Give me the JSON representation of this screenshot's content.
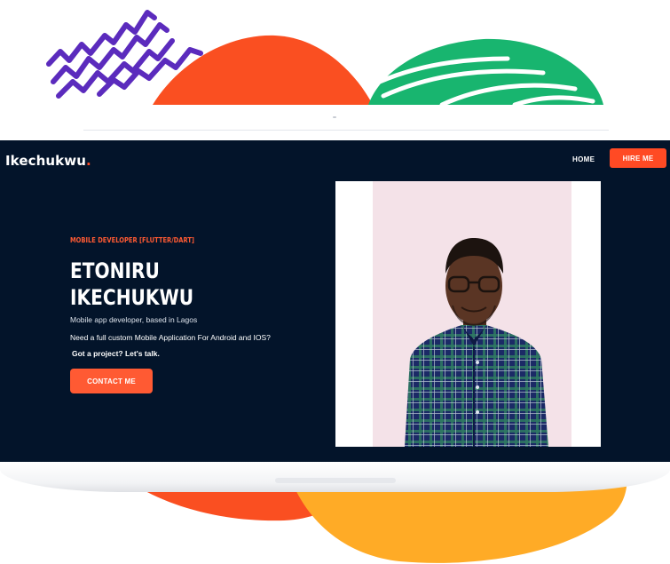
{
  "brand": {
    "name": "Ikechukwu",
    "dot": "."
  },
  "nav": {
    "home_label": "HOME",
    "hire_label": "HIRE ME"
  },
  "hero": {
    "subtitle": "MOBILE DEVELOPER [FLUTTER/DART]",
    "name_line1": "ETONIRU",
    "name_line2": "IKECHUKWU",
    "tagline": "Mobile app developer, based in Lagos",
    "pitch": "Need a full custom Mobile Application For Android and IOS?",
    "cta_text": "Got a project? Let's talk.",
    "contact_label": "CONTACT ME"
  },
  "colors": {
    "accent": "#ff4a24",
    "background": "#03142a",
    "deco_purple": "#5b2bbd",
    "deco_orange": "#fa4f21",
    "deco_green": "#18b56f",
    "deco_yellow": "#ffab26"
  },
  "profile_photo": {
    "subject": "portrait of developer in plaid shirt and glasses"
  }
}
